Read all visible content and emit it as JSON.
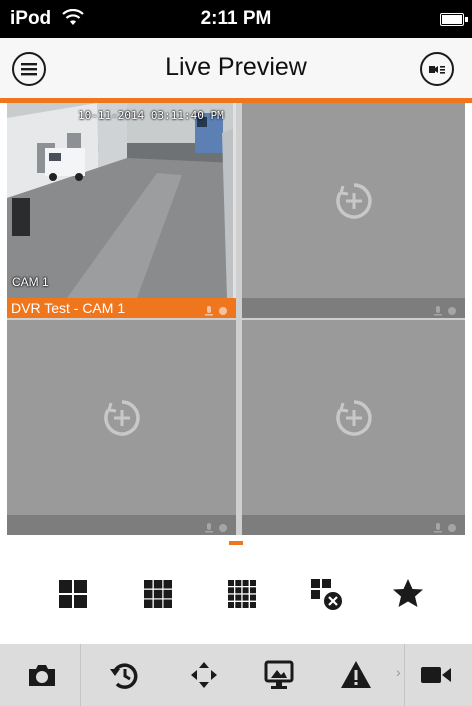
{
  "status_bar": {
    "carrier": "iPod",
    "time": "2:11 PM"
  },
  "header": {
    "title": "Live Preview"
  },
  "tiles": [
    {
      "label": "DVR Test - CAM 1",
      "osd_time": "10-11-2014 03:11:40 PM",
      "osd_cam": "CAM 1",
      "state": "live"
    },
    {
      "label": "",
      "state": "empty"
    },
    {
      "label": "",
      "state": "empty"
    },
    {
      "label": "",
      "state": "empty"
    }
  ],
  "layout_buttons": [
    "grid-2x2-icon",
    "grid-3x3-icon",
    "grid-4x4-icon",
    "close-all-icon",
    "favorite-star-icon"
  ],
  "bottom_buttons": [
    "snapshot-icon",
    "playback-icon",
    "ptz-icon",
    "remote-display-icon",
    "alarm-icon",
    "record-icon"
  ],
  "colors": {
    "accent": "#f0761e",
    "tile": "#9a9a9a",
    "tile_footer": "#7d7d7d",
    "toolbar": "#dcdcdc"
  }
}
